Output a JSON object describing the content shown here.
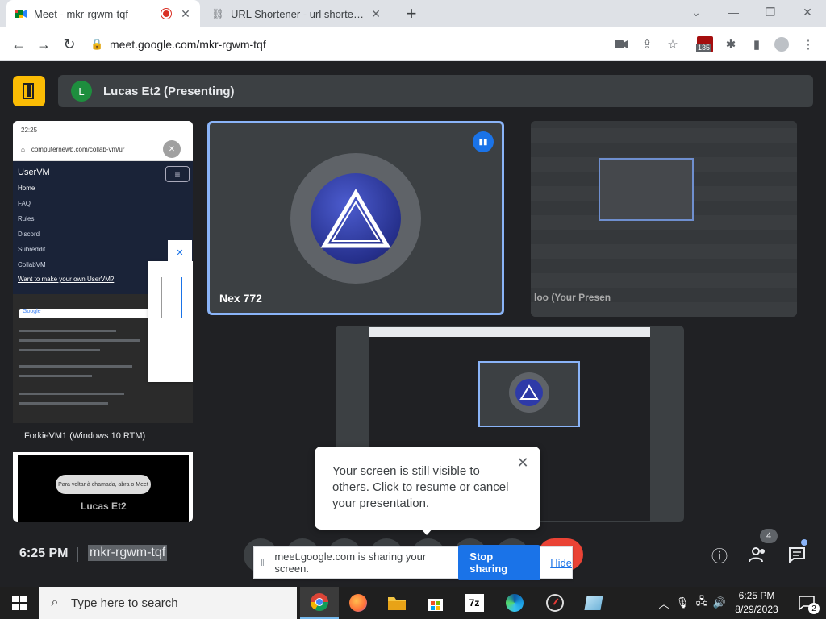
{
  "browser": {
    "tabs": [
      {
        "title": "Meet - mkr-rgwm-tqf",
        "active": true
      },
      {
        "title": "URL Shortener - url shortening se",
        "active": false
      }
    ],
    "url": "meet.google.com/mkr-rgwm-tqf",
    "extension_badge": "135"
  },
  "meet": {
    "presenting_label": "Lucas Et2 (Presenting)",
    "presenter_initial": "L",
    "left_tile": {
      "phone_time": "22:25",
      "phone_url": "computernewb.com/collab-vm/ur",
      "brand": "UserVM",
      "menu": [
        "Home",
        "FAQ",
        "Rules",
        "Discord",
        "Subreddit",
        "CollabVM"
      ],
      "promo_link": "Want to make your own UserVM?",
      "search_logo": "Google",
      "vm_label": "ForkieVM1 (Windows 10 RTM)",
      "preview_pill": "Para voltar à chamada, abra o Meet",
      "preview_name": "Lucas Et2"
    },
    "main_tile_name": "Nex 772",
    "right_tile_caption": "loo (Your Presen",
    "time": "6:25 PM",
    "meeting_code": "mkr-rgwm-tqf",
    "participant_count": "4"
  },
  "tooltip": {
    "message": "Your screen is still visible to others. Click to resume or cancel your presentation."
  },
  "sharebar": {
    "text": "meet.google.com is sharing your screen.",
    "stop_label": "Stop sharing",
    "hide_label": "Hide"
  },
  "taskbar": {
    "search_placeholder": "Type here to search",
    "clock_time": "6:25 PM",
    "clock_date": "8/29/2023",
    "notification_count": "2"
  },
  "colors": {
    "accent_blue": "#1a73e8",
    "end_call_red": "#ea4335",
    "meet_bg": "#202124",
    "leave_yellow": "#fbbc04"
  }
}
